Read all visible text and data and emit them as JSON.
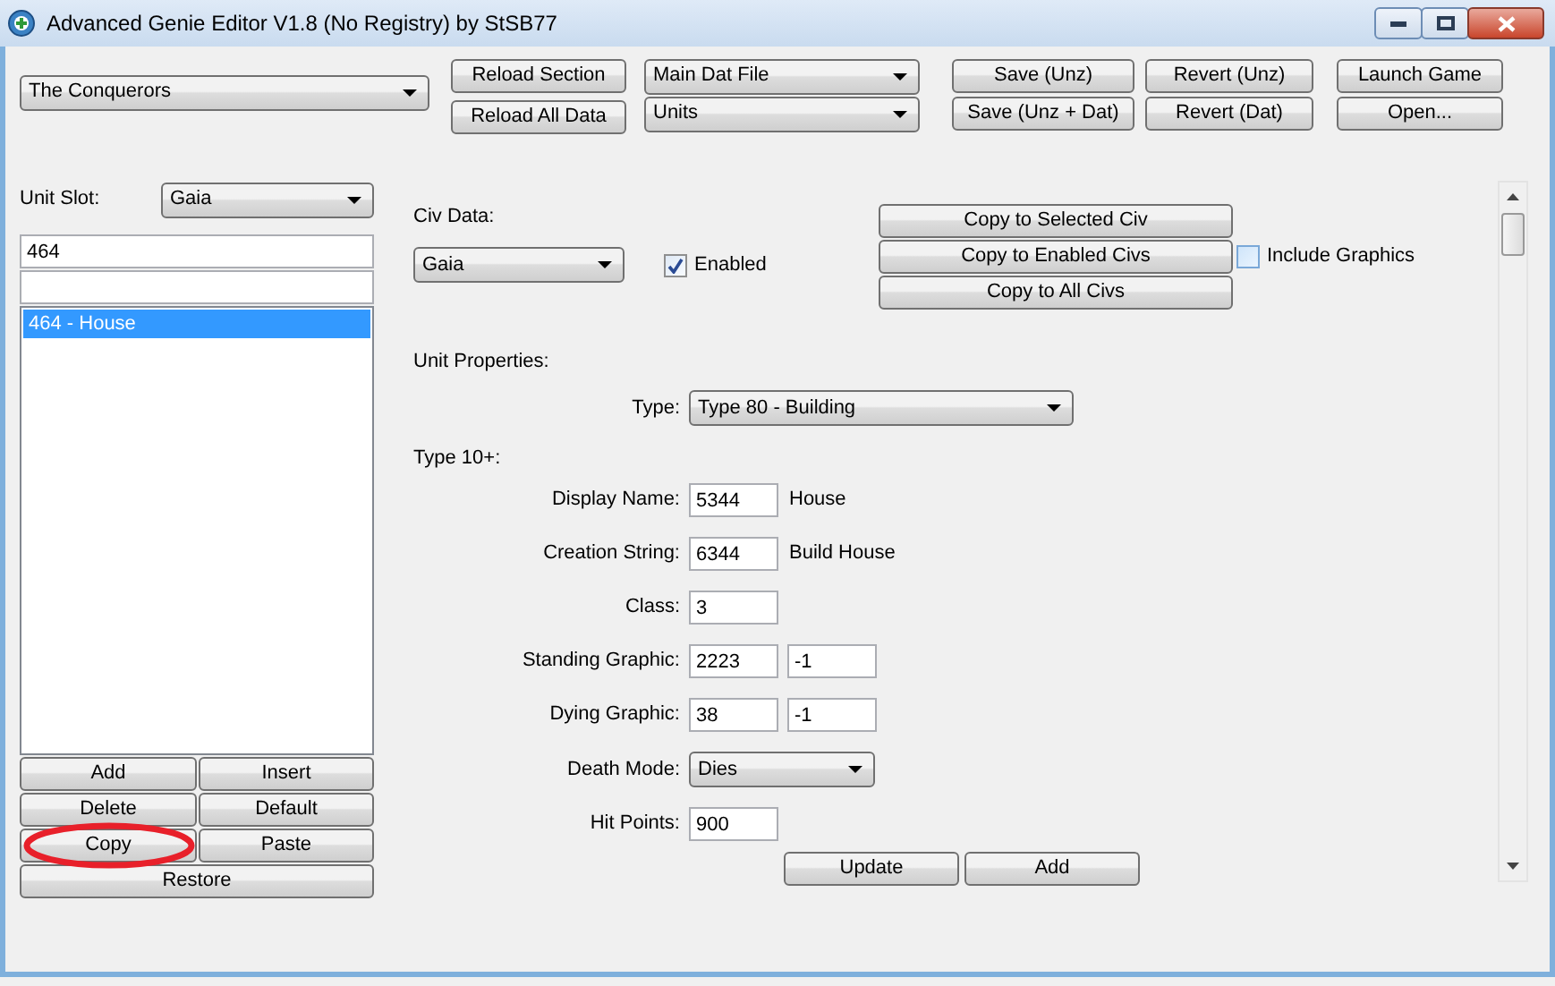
{
  "window": {
    "title": "Advanced Genie Editor V1.8 (No Registry) by StSB77"
  },
  "toolbar": {
    "game_select": {
      "value": "The Conquerors"
    },
    "reload_buttons": [
      "Reload Section",
      "Reload All Data"
    ],
    "file_select": {
      "value": "Main Dat File"
    },
    "section_select": {
      "value": "Units"
    },
    "button_columns": [
      [
        "Save (Unz)",
        "Save (Unz + Dat)"
      ],
      [
        "Revert (Unz)",
        "Revert (Dat)"
      ],
      [
        "Launch Game",
        "Open..."
      ]
    ]
  },
  "left_panel": {
    "unit_slot_label": "Unit Slot:",
    "unit_slot_select": {
      "value": "Gaia"
    },
    "search": {
      "value": "464"
    },
    "units": [
      {
        "label": "464 - House",
        "selected": true
      }
    ],
    "buttons": [
      {
        "label": "Add",
        "circled": false
      },
      {
        "label": "Insert",
        "circled": false
      },
      {
        "label": "Delete",
        "circled": false
      },
      {
        "label": "Default",
        "circled": false
      },
      {
        "label": "Copy",
        "circled": true
      },
      {
        "label": "Paste",
        "circled": false
      }
    ],
    "restore_button": "Restore"
  },
  "right_panel": {
    "civ_data_label": "Civ Data:",
    "civ_select": {
      "value": "Gaia"
    },
    "enabled": {
      "label": "Enabled",
      "checked": true
    },
    "copy_buttons": [
      "Copy to Selected Civ",
      "Copy to Enabled Civs",
      "Copy to All Civs"
    ],
    "include_graphics": {
      "label": "Include Graphics",
      "checked": false
    },
    "unit_properties_label": "Unit Properties:",
    "type": {
      "label": "Type:",
      "value": "Type 80 - Building"
    },
    "section_label": "Type 10+:",
    "fields": [
      {
        "kind": "note",
        "label": "Display Name:",
        "value": "5344",
        "note": "House"
      },
      {
        "kind": "note",
        "label": "Creation String:",
        "value": "6344",
        "note": "Build House"
      },
      {
        "kind": "single",
        "label": "Class:",
        "value": "3"
      },
      {
        "kind": "pair",
        "label": "Standing Graphic:",
        "value": "2223",
        "value_2": "-1"
      },
      {
        "kind": "pair",
        "label": "Dying Graphic:",
        "value": "38",
        "value_2": "-1"
      },
      {
        "kind": "select",
        "label": "Death Mode:",
        "value": "Dies"
      },
      {
        "kind": "single",
        "label": "Hit Points:",
        "value": "900"
      }
    ],
    "bottom_buttons": [
      "Update",
      "Add"
    ]
  }
}
